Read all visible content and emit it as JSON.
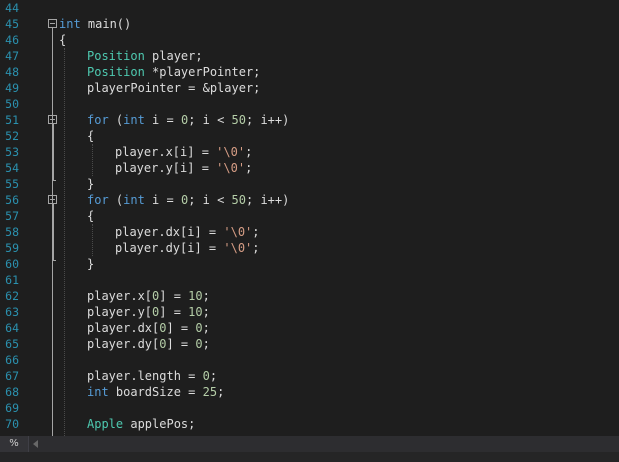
{
  "editor": {
    "line_numbers": [
      "44",
      "45",
      "46",
      "47",
      "48",
      "49",
      "50",
      "51",
      "52",
      "53",
      "54",
      "55",
      "56",
      "57",
      "58",
      "59",
      "60",
      "61",
      "62",
      "63",
      "64",
      "65",
      "66",
      "67",
      "68",
      "69",
      "70"
    ]
  },
  "code": {
    "l45": {
      "kw": "int",
      "rest": " main()"
    },
    "l46": "{",
    "l47": {
      "type": "Position",
      "rest": " player;"
    },
    "l48": {
      "type": "Position",
      "rest": " *playerPointer;"
    },
    "l49": "playerPointer = &player;",
    "l51": {
      "kw1": "for",
      "p1": " (",
      "kw2": "int",
      "p2": " i = ",
      "n1": "0",
      "p3": "; i < ",
      "n2": "50",
      "p4": "; i++)"
    },
    "l52": "{",
    "l53": {
      "pre": "player.x[i] = ",
      "str": "'\\0'",
      "post": ";"
    },
    "l54": {
      "pre": "player.y[i] = ",
      "str": "'\\0'",
      "post": ";"
    },
    "l55": "}",
    "l56": {
      "kw1": "for",
      "p1": " (",
      "kw2": "int",
      "p2": " i = ",
      "n1": "0",
      "p3": "; i < ",
      "n2": "50",
      "p4": "; i++)"
    },
    "l57": "{",
    "l58": {
      "pre": "player.dx[i] = ",
      "str": "'\\0'",
      "post": ";"
    },
    "l59": {
      "pre": "player.dy[i] = ",
      "str": "'\\0'",
      "post": ";"
    },
    "l60": "}",
    "l62": {
      "pre": "player.x[",
      "n1": "0",
      "mid": "] = ",
      "n2": "10",
      "post": ";"
    },
    "l63": {
      "pre": "player.y[",
      "n1": "0",
      "mid": "] = ",
      "n2": "10",
      "post": ";"
    },
    "l64": {
      "pre": "player.dx[",
      "n1": "0",
      "mid": "] = ",
      "n2": "0",
      "post": ";"
    },
    "l65": {
      "pre": "player.dy[",
      "n1": "0",
      "mid": "] = ",
      "n2": "0",
      "post": ";"
    },
    "l67": {
      "pre": "player.length = ",
      "n": "0",
      "post": ";"
    },
    "l68": {
      "kw": "int",
      "pre": " boardSize = ",
      "n": "25",
      "post": ";"
    },
    "l70": {
      "type": "Apple",
      "rest": " applePos;"
    }
  },
  "status": {
    "zoom_text": "%"
  },
  "colors": {
    "background": "#1e1e1e",
    "line_number": "#2b91af",
    "keyword": "#569cd6",
    "type": "#4ec9b0",
    "number": "#b5cea8",
    "string": "#d69d85",
    "text": "#dcdcdc"
  }
}
